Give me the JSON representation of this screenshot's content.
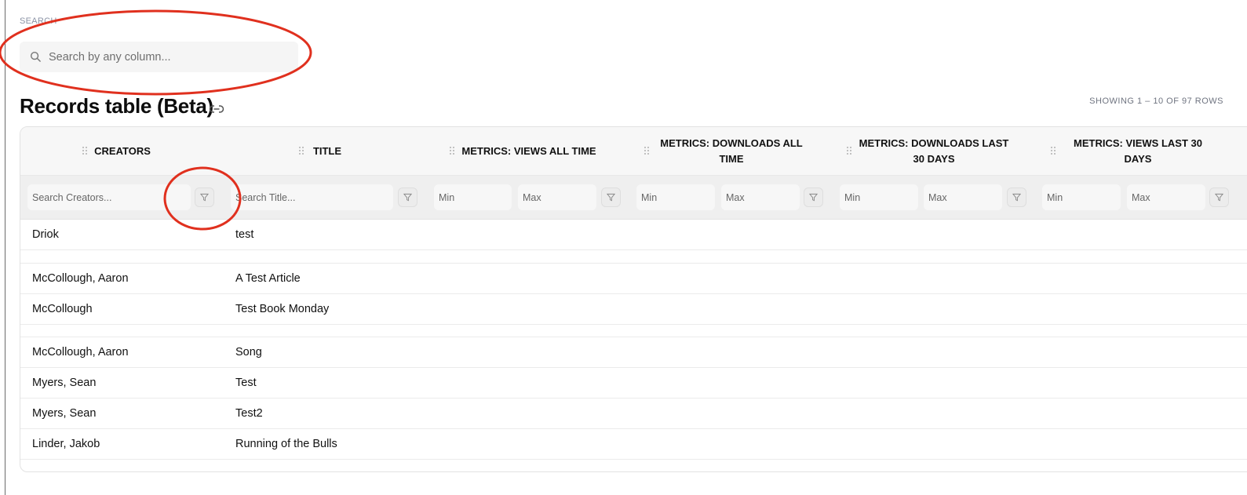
{
  "search": {
    "label": "SEARCH",
    "placeholder": "Search by any column...",
    "value": ""
  },
  "header": {
    "title": "Records table (Beta)",
    "row_count": "SHOWING 1 – 10 OF 97 ROWS"
  },
  "table": {
    "columns": [
      {
        "label": "CREATORS"
      },
      {
        "label": "TITLE"
      },
      {
        "label": "METRICS: VIEWS ALL TIME"
      },
      {
        "label": "METRICS: DOWNLOADS ALL TIME"
      },
      {
        "label": "METRICS: DOWNLOADS LAST 30 DAYS"
      },
      {
        "label": "METRICS: VIEWS LAST 30 DAYS"
      }
    ],
    "filters": {
      "creators_placeholder": "Search Creators...",
      "title_placeholder": "Search Title...",
      "min_placeholder": "Min",
      "max_placeholder": "Max"
    },
    "rows": [
      {
        "creators": "Driok",
        "title": "test"
      },
      {
        "creators": "",
        "title": ""
      },
      {
        "creators": "McCollough, Aaron",
        "title": "A Test Article"
      },
      {
        "creators": "McCollough",
        "title": "Test Book Monday"
      },
      {
        "creators": "",
        "title": ""
      },
      {
        "creators": "McCollough, Aaron",
        "title": "Song"
      },
      {
        "creators": "Myers, Sean",
        "title": "Test"
      },
      {
        "creators": "Myers, Sean",
        "title": "Test2"
      },
      {
        "creators": "Linder, Jakob",
        "title": "Running of the Bulls"
      }
    ]
  },
  "annotations": {
    "color": "#e0301e"
  },
  "icons": [
    "search-icon",
    "link-icon",
    "drag-handle-icon",
    "filter-icon"
  ]
}
